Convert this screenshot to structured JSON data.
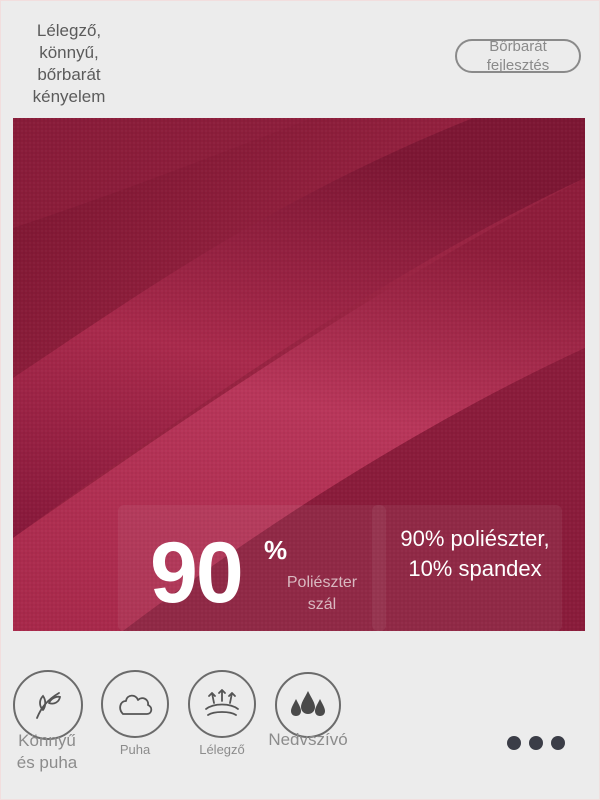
{
  "header": {
    "headline": "Lélegző, könnyű, bőrbarát kényelem",
    "pill_label": "Bőrbarát fejlesztés"
  },
  "stat": {
    "value": "90",
    "unit": "%",
    "label": "Poliészter szál"
  },
  "composition": "90% poliészter, 10% spandex",
  "features": [
    {
      "label": "Könnyű és puha",
      "icon": "feather-icon"
    },
    {
      "label": "Puha",
      "icon": "cloud-icon"
    },
    {
      "label": "Lélegző",
      "icon": "breathable-icon"
    },
    {
      "label": "Nedvszívó",
      "icon": "droplets-icon"
    }
  ],
  "colors": {
    "fabric": "#8d1e3b",
    "background": "#ececec"
  }
}
